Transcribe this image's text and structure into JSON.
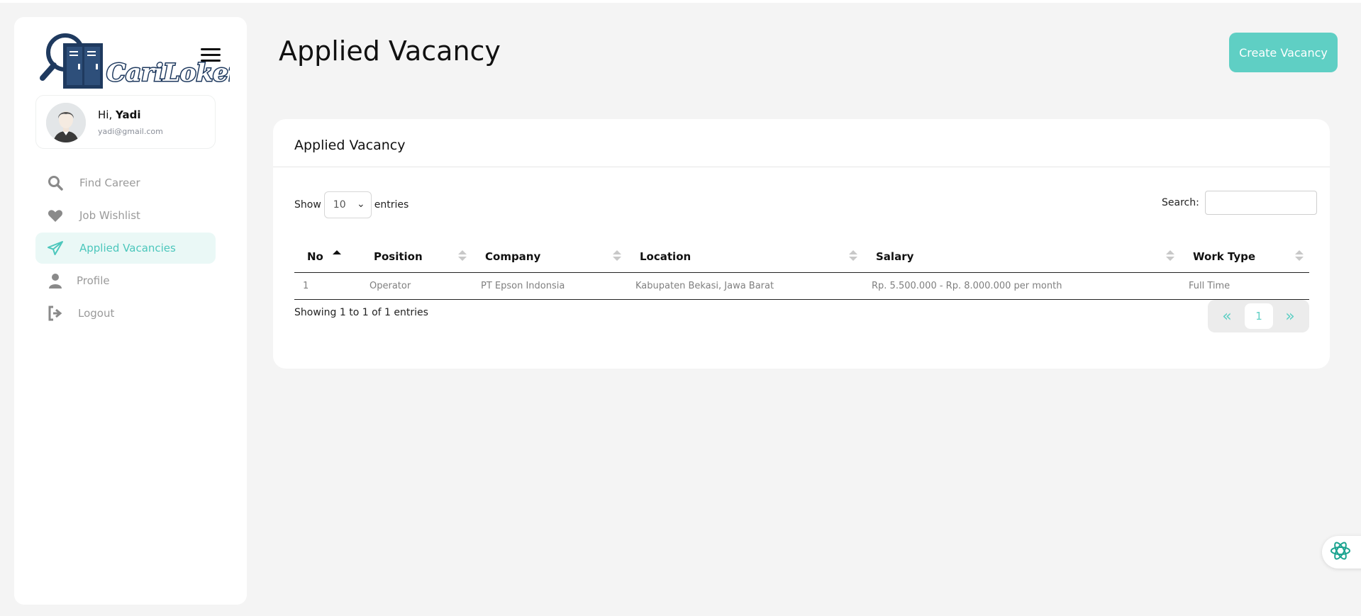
{
  "brand": {
    "logo_text": "CariLoker"
  },
  "user": {
    "greeting": "Hi,",
    "name": "Yadi",
    "email": "yadi@gmail.com"
  },
  "nav": {
    "items": [
      {
        "label": "Find Career",
        "icon": "search-icon"
      },
      {
        "label": "Job Wishlist",
        "icon": "heart-icon"
      },
      {
        "label": "Applied Vacancies",
        "icon": "paper-plane-icon",
        "active": true
      },
      {
        "label": "Profile",
        "icon": "user-icon"
      },
      {
        "label": "Logout",
        "icon": "logout-icon"
      }
    ]
  },
  "header": {
    "title": "Applied Vacancy",
    "create_label": "Create Vacancy"
  },
  "card": {
    "title": "Applied Vacancy",
    "show_label": "Show",
    "entries_value": "10",
    "entries_label": "entries",
    "search_label": "Search:",
    "search_value": ""
  },
  "table": {
    "columns": [
      "No",
      "Position",
      "Company",
      "Location",
      "Salary",
      "Work Type"
    ],
    "rows": [
      [
        "1",
        "Operator",
        "PT Epson Indonsia",
        "Kabupaten Bekasi, Jawa Barat",
        "Rp. 5.500.000 - Rp. 8.000.000 per month",
        "Full Time"
      ]
    ]
  },
  "footer": {
    "info": "Showing 1 to 1 of 1 entries",
    "page": "1",
    "prev": "«",
    "next": "»"
  },
  "colors": {
    "accent": "#5fcfc4",
    "brand_navy": "#1f3a5f",
    "background": "#f4f4f4"
  }
}
